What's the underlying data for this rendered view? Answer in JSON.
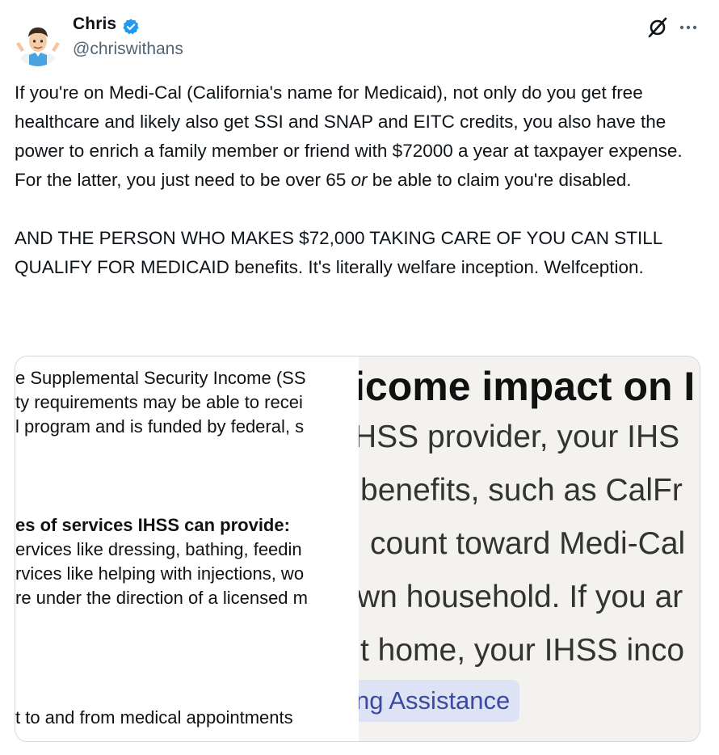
{
  "author": {
    "name": "Chris",
    "handle": "@chriswithans",
    "verified_color": "#1d9bf0",
    "avatar_icon": "memoji-avatar-icon"
  },
  "header_icons": [
    "grok-icon",
    "more-icon"
  ],
  "tweet": {
    "p1_a": "If you're on Medi-Cal (California's name for Medicaid), not only do you get free healthcare and likely also get SSI and SNAP and EITC credits, you also have the power to enrich a family member or friend with $72000 a year at taxpayer expense.  For the latter, you just need to be over 65 ",
    "p1_em": "or",
    "p1_b": " be able to claim you're disabled.",
    "p2": "AND THE PERSON WHO MAKES $72,000 TAKING CARE OF YOU CAN STILL QUALIFY FOR MEDICAID benefits.  It's literally welfare inception.  Welfception."
  },
  "media": {
    "left_lines": [
      "e Supplemental Security Income (SS",
      "ty requirements may be able to recei",
      "l program and is funded by federal, s",
      "es of services IHSS can provide:",
      "ervices like dressing, bathing, feedin",
      "rvices like helping with injections, wo",
      "re under the direction of a licensed m",
      "t to and from medical appointments"
    ],
    "right_heading": "icome impact on I",
    "right_lines": [
      "HSS provider, your IHS",
      "benefits, such as CalFr",
      "count toward Medi-Cal",
      "wn household. If you ar",
      "t home, your IHSS inco"
    ],
    "right_pill": "ng Assistance"
  }
}
